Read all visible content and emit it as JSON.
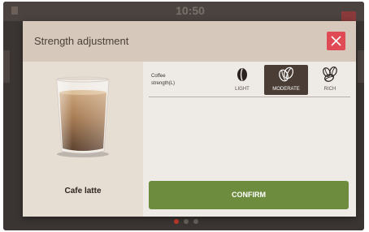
{
  "background": {
    "time": "10:50"
  },
  "modal": {
    "title": "Strength adjustment",
    "product_name": "Cafe latte",
    "strength": {
      "label_line1": "Coffee",
      "label_line2": "strength(L)",
      "options": [
        {
          "label": "LIGHT",
          "icon": "one-bean-icon",
          "selected": false
        },
        {
          "label": "MODERATE",
          "icon": "two-beans-icon",
          "selected": true
        },
        {
          "label": "RICH",
          "icon": "three-beans-icon",
          "selected": false
        }
      ]
    },
    "confirm_label": "CONFIRM"
  },
  "colors": {
    "header": "#d6c8bb",
    "close": "#e04a55",
    "confirm": "#6d8c3e",
    "selected_option": "#4a3d36"
  },
  "pagination": {
    "pages": 3,
    "active_index": 0
  }
}
